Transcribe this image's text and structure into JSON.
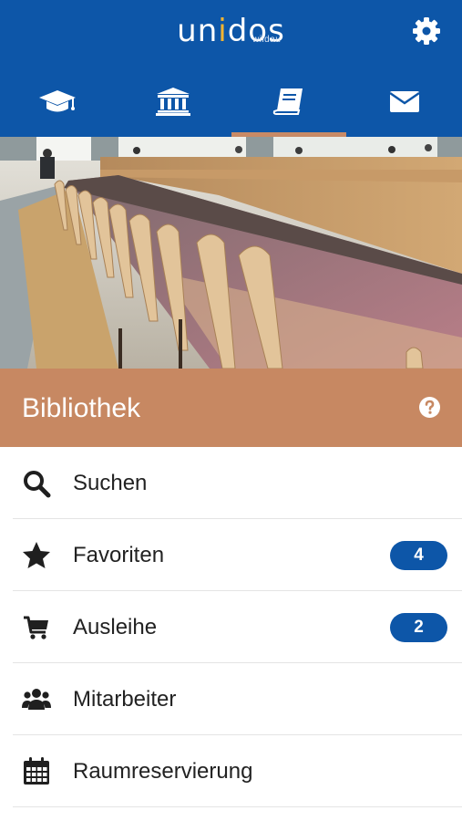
{
  "header": {
    "logo_parts": [
      "un",
      "i",
      "dos"
    ],
    "logo_subtitle": "wildau",
    "settings_icon": "gear-icon",
    "brand_color": "#0d56a8",
    "accent_color": "#f2b431"
  },
  "tabs": [
    {
      "icon": "graduation-cap-icon",
      "selected": false
    },
    {
      "icon": "university-icon",
      "selected": false
    },
    {
      "icon": "book-icon",
      "selected": true
    },
    {
      "icon": "envelope-icon",
      "selected": false
    }
  ],
  "hero": {
    "icon": "library-photo"
  },
  "section": {
    "title": "Bibliothek",
    "help_icon": "question-circle-icon",
    "color": "#c78862"
  },
  "menu": {
    "items": [
      {
        "label": "Suchen",
        "icon": "search-icon",
        "badge": null
      },
      {
        "label": "Favoriten",
        "icon": "star-icon",
        "badge": "4"
      },
      {
        "label": "Ausleihe",
        "icon": "cart-icon",
        "badge": "2"
      },
      {
        "label": "Mitarbeiter",
        "icon": "users-icon",
        "badge": null
      },
      {
        "label": "Raumreservierung",
        "icon": "calendar-icon",
        "badge": null
      }
    ]
  }
}
